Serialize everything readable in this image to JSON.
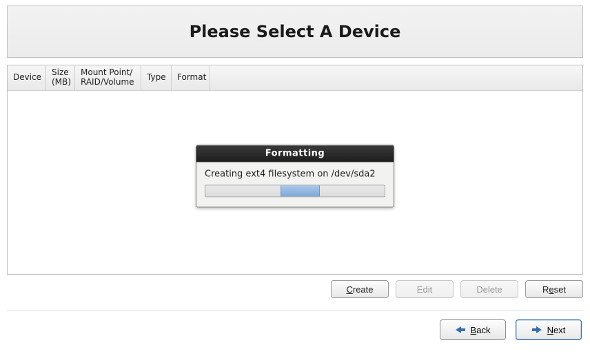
{
  "title": "Please Select A Device",
  "columns": {
    "device": "Device",
    "size": "Size (MB)",
    "mount": "Mount Point/ RAID/Volume",
    "type": "Type",
    "format": "Format"
  },
  "buttons": {
    "create": "Create",
    "edit": "Edit",
    "delete": "Delete",
    "reset": "Reset"
  },
  "nav": {
    "back": "Back",
    "next": "Next"
  },
  "dialog": {
    "title": "Formatting",
    "message": "Creating ext4 filesystem on /dev/sda2",
    "progress_left_pct": 42,
    "progress_width_pct": 22
  }
}
